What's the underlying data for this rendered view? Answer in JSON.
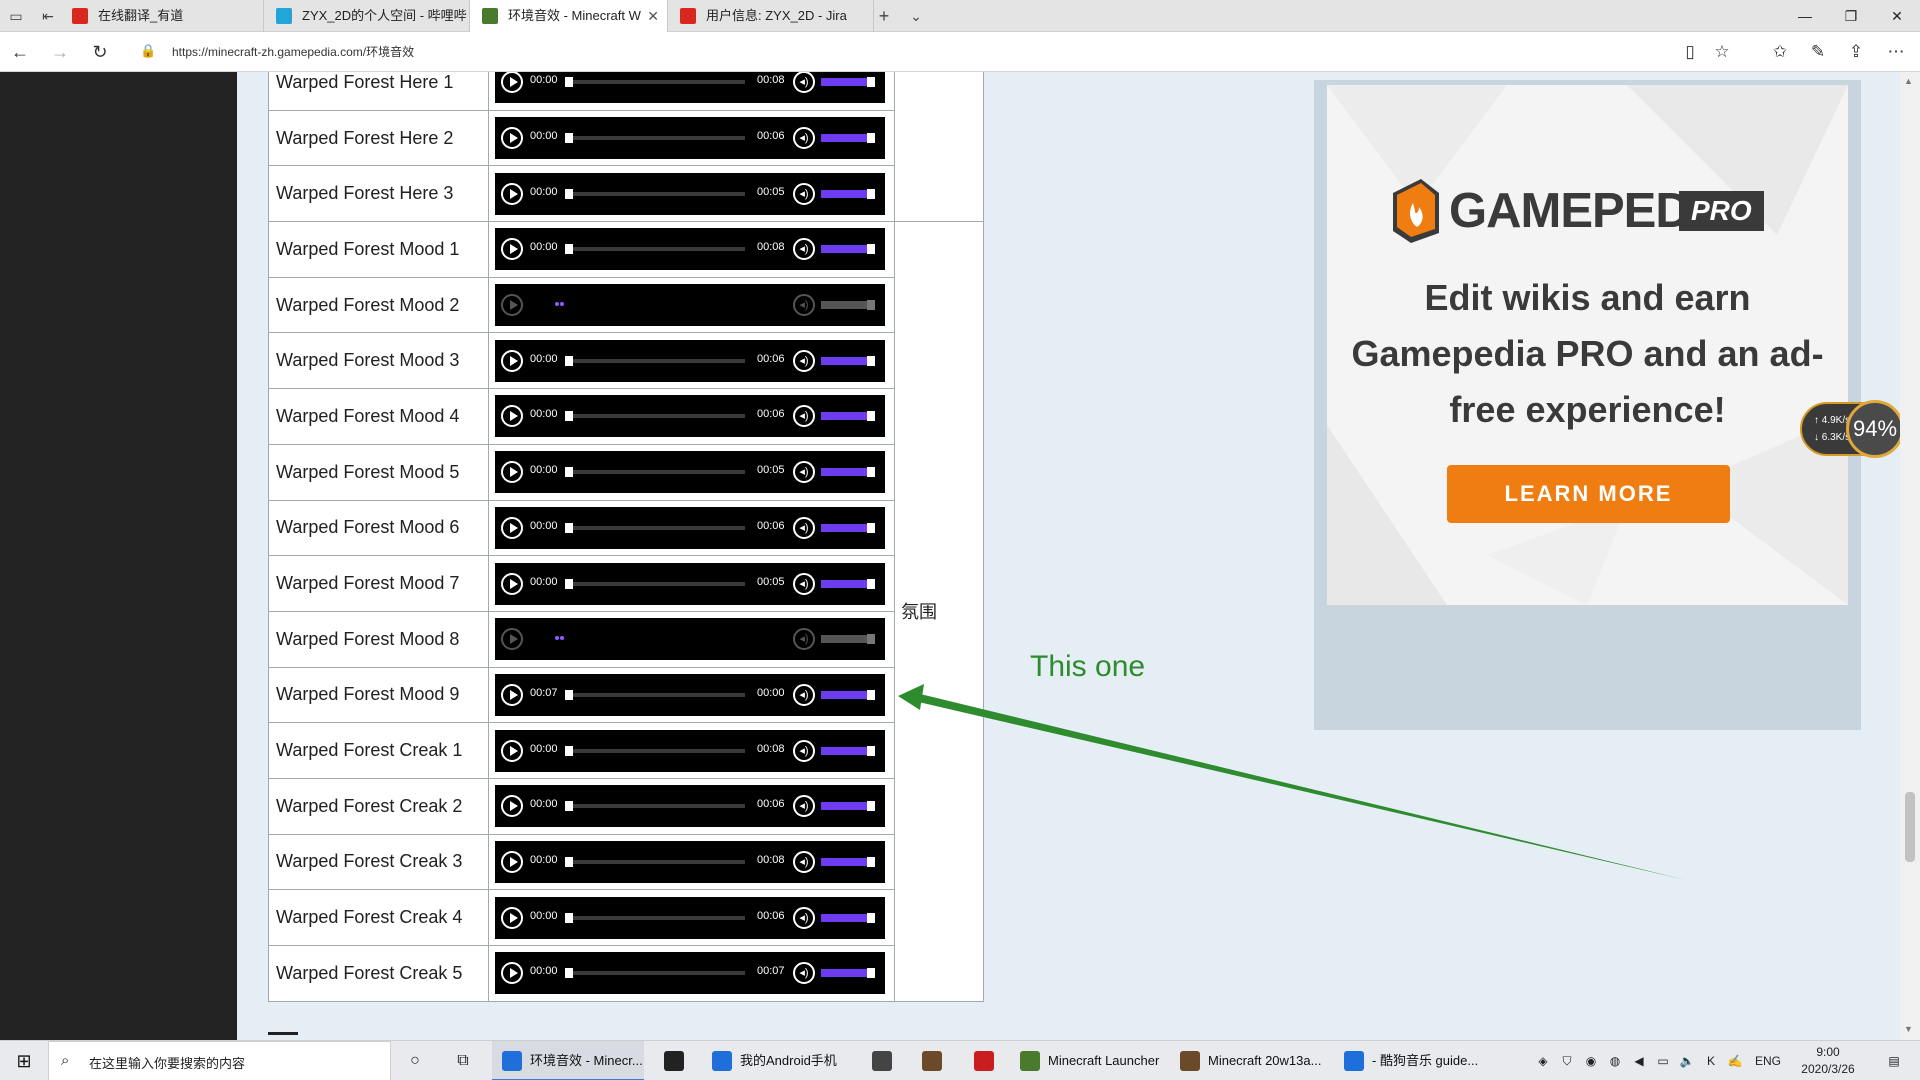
{
  "browser": {
    "tabs": [
      {
        "label": "在线翻译_有道",
        "color": "#d6281f",
        "glyph": "y"
      },
      {
        "label": "ZYX_2D的个人空间 - 哔哩哔",
        "color": "#23a5d9",
        "glyph": "tv"
      },
      {
        "label": "环境音效 - Minecraft W",
        "color": "#4a7a2c",
        "glyph": "mc"
      },
      {
        "label": "用户信息: ZYX_2D - Jira",
        "color": "#d6281f",
        "glyph": "jira"
      }
    ],
    "url": "https://minecraft-zh.gamepedia.com/环境音效"
  },
  "sounds": {
    "rows": [
      {
        "name": "Warped Forest Here 1",
        "start": "00:00",
        "end": "00:08",
        "loading": false
      },
      {
        "name": "Warped Forest Here 2",
        "start": "00:00",
        "end": "00:06",
        "loading": false
      },
      {
        "name": "Warped Forest Here 3",
        "start": "00:00",
        "end": "00:05",
        "loading": false
      },
      {
        "name": "Warped Forest Mood 1",
        "start": "00:00",
        "end": "00:08",
        "loading": false
      },
      {
        "name": "Warped Forest Mood 2",
        "start": "",
        "end": "",
        "loading": true
      },
      {
        "name": "Warped Forest Mood 3",
        "start": "00:00",
        "end": "00:06",
        "loading": false
      },
      {
        "name": "Warped Forest Mood 4",
        "start": "00:00",
        "end": "00:06",
        "loading": false
      },
      {
        "name": "Warped Forest Mood 5",
        "start": "00:00",
        "end": "00:05",
        "loading": false
      },
      {
        "name": "Warped Forest Mood 6",
        "start": "00:00",
        "end": "00:06",
        "loading": false
      },
      {
        "name": "Warped Forest Mood 7",
        "start": "00:00",
        "end": "00:05",
        "loading": false
      },
      {
        "name": "Warped Forest Mood 8",
        "start": "",
        "end": "",
        "loading": true
      },
      {
        "name": "Warped Forest Mood 9",
        "start": "00:07",
        "end": "00:00",
        "loading": false
      },
      {
        "name": "Warped Forest Creak 1",
        "start": "00:00",
        "end": "00:08",
        "loading": false
      },
      {
        "name": "Warped Forest Creak 2",
        "start": "00:00",
        "end": "00:06",
        "loading": false
      },
      {
        "name": "Warped Forest Creak 3",
        "start": "00:00",
        "end": "00:08",
        "loading": false
      },
      {
        "name": "Warped Forest Creak 4",
        "start": "00:00",
        "end": "00:06",
        "loading": false
      },
      {
        "name": "Warped Forest Creak 5",
        "start": "00:00",
        "end": "00:07",
        "loading": false
      }
    ],
    "group_label": "氛围"
  },
  "annotation": {
    "text": "This one",
    "color": "#2e8b2e"
  },
  "ad": {
    "brand": "GAMEPEDIA",
    "brand_badge": "PRO",
    "headline": "Edit wikis and earn Gamepedia PRO and an ad-free experience!",
    "cta": "LEARN MORE",
    "accent": "#f07d12"
  },
  "net_widget": {
    "up": "↑ 4.9K/s",
    "down": "↓ 6.3K/s",
    "percent": "94%"
  },
  "taskbar": {
    "search_placeholder": "在这里输入你要搜索的内容",
    "apps": [
      {
        "label": "环境音效 - Minecr...",
        "color": "#1e6fd9",
        "active": true
      },
      {
        "label": "",
        "color": "#222222",
        "active": false
      },
      {
        "label": "我的Android手机",
        "color": "#1e6fd9",
        "active": false
      },
      {
        "label": "",
        "color": "#444444",
        "active": false
      },
      {
        "label": "",
        "color": "#6b4a2a",
        "active": false
      },
      {
        "label": "",
        "color": "#c81e1e",
        "active": false
      },
      {
        "label": "Minecraft Launcher",
        "color": "#4a7a2c",
        "active": false
      },
      {
        "label": "Minecraft 20w13a...",
        "color": "#6b4a2a",
        "active": false
      },
      {
        "label": "- 酷狗音乐 guide...",
        "color": "#1e6fd9",
        "active": false
      }
    ],
    "lang": "ENG",
    "time": "9:00",
    "date": "2020/3/26"
  }
}
